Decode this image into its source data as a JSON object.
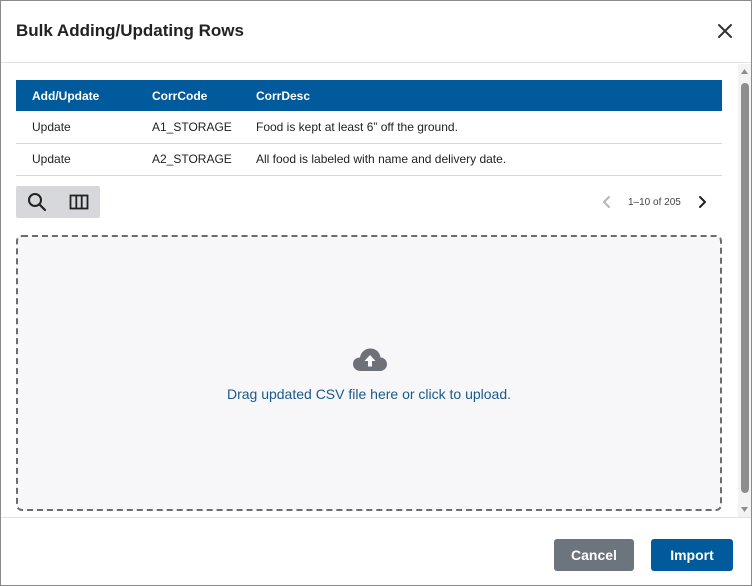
{
  "dialog": {
    "title": "Bulk Adding/Updating Rows"
  },
  "table": {
    "columns": [
      "Add/Update",
      "CorrCode",
      "CorrDesc"
    ],
    "rows": [
      [
        "Update",
        "A1_STORAGE",
        "Food is kept at least 6” off the ground."
      ],
      [
        "Update",
        "A2_STORAGE",
        "All food is labeled with name and delivery date."
      ]
    ]
  },
  "toolbar": {
    "search_icon": "search-icon",
    "columns_icon": "columns-icon"
  },
  "pager": {
    "info": "1–10 of 205"
  },
  "dropzone": {
    "text": "Drag updated CSV file here or click to upload.",
    "icon": "cloud-upload-icon"
  },
  "footer": {
    "cancel_label": "Cancel",
    "import_label": "Import"
  },
  "colors": {
    "header_blue": "#005a9c",
    "cancel_gray": "#6c757d",
    "link_blue": "#1a5a8a"
  }
}
